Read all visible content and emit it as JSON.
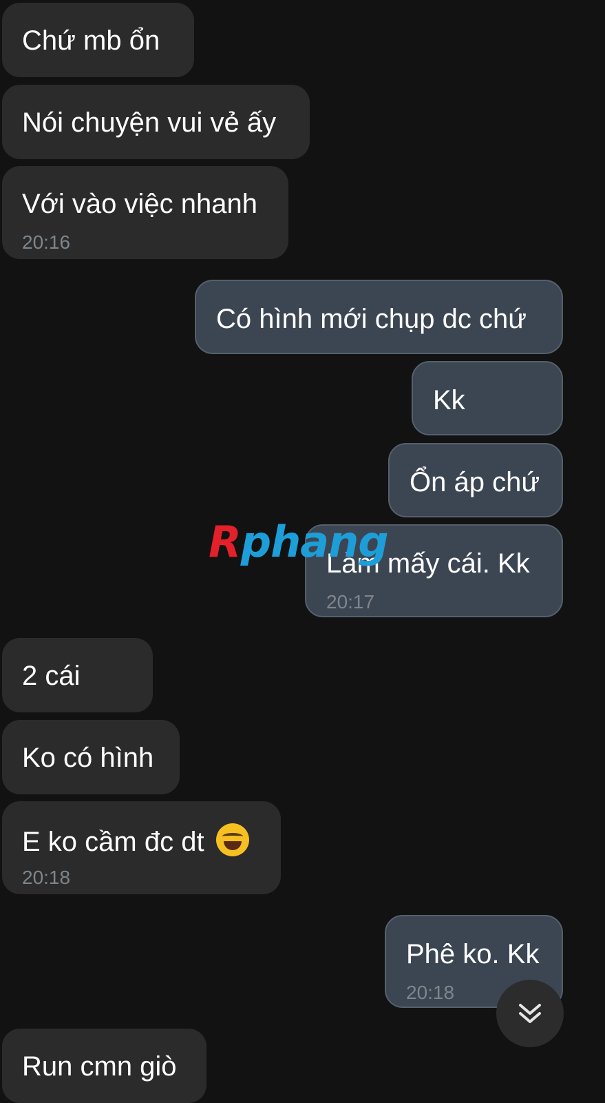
{
  "messages": [
    {
      "direction": "in",
      "text": "Chứ mb ổn",
      "time": ""
    },
    {
      "direction": "in",
      "text": "Nói chuyện vui vẻ ấy",
      "time": ""
    },
    {
      "direction": "in",
      "text": "Với vào việc nhanh",
      "time": "20:16"
    },
    {
      "direction": "out",
      "text": "Có hình mới chụp dc chứ",
      "time": ""
    },
    {
      "direction": "out",
      "text": "Kk",
      "time": ""
    },
    {
      "direction": "out",
      "text": "Ổn áp chứ",
      "time": ""
    },
    {
      "direction": "out",
      "text": "Làm mấy cái. Kk",
      "time": "20:17"
    },
    {
      "direction": "in",
      "text": "2 cái",
      "time": ""
    },
    {
      "direction": "in",
      "text": "Ko có hình",
      "time": ""
    },
    {
      "direction": "in",
      "text": "E ko cầm đc dt",
      "emoji": "rolling-on-floor-laughing",
      "time": "20:18"
    },
    {
      "direction": "out",
      "text": "Phê ko. Kk",
      "time": "20:18"
    },
    {
      "direction": "in",
      "text": "Run cmn giò",
      "time": ""
    }
  ],
  "watermark": {
    "part1": "R",
    "part2": "phang"
  },
  "scroll_button": {
    "icon": "double-chevron-down-icon"
  },
  "colors": {
    "background": "#121212",
    "incoming_bubble": "#2b2b2b",
    "outgoing_bubble": "#3c4653",
    "timestamp": "#7f858c"
  }
}
